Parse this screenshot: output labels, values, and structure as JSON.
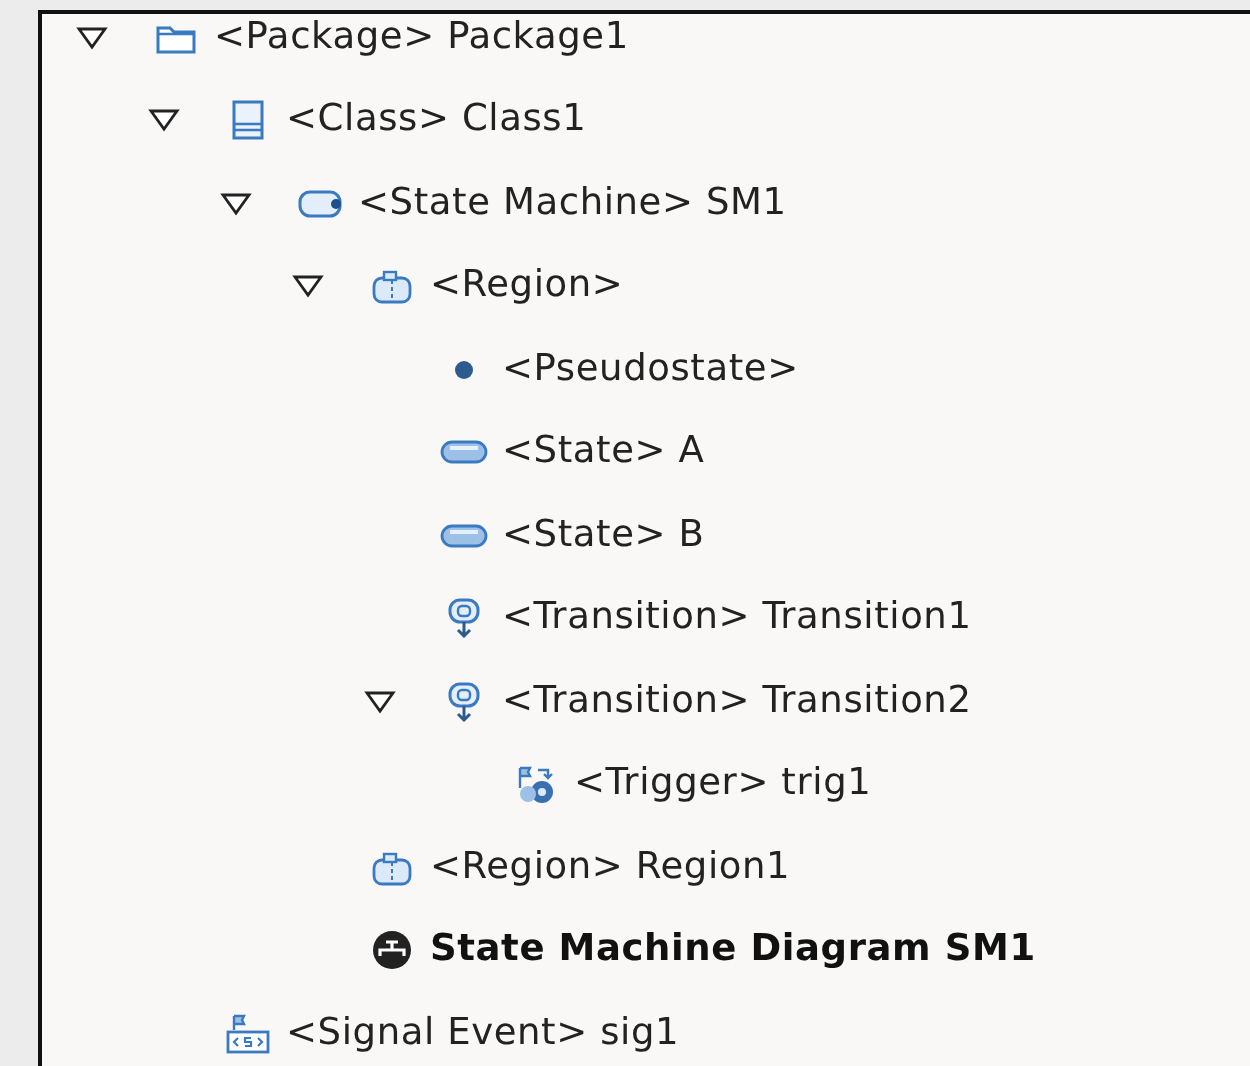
{
  "tree": {
    "items": [
      {
        "kind": "package",
        "label": "<Package> Package1",
        "expanded": true,
        "children": [
          {
            "kind": "class",
            "label": "<Class> Class1",
            "expanded": true,
            "children": [
              {
                "kind": "state-machine",
                "label": "<State Machine> SM1",
                "expanded": true,
                "children": [
                  {
                    "kind": "region",
                    "label": "<Region>",
                    "expanded": true,
                    "children": [
                      {
                        "kind": "pseudostate",
                        "label": "<Pseudostate>"
                      },
                      {
                        "kind": "state",
                        "label": "<State> A"
                      },
                      {
                        "kind": "state",
                        "label": "<State> B"
                      },
                      {
                        "kind": "transition",
                        "label": "<Transition> Transition1"
                      },
                      {
                        "kind": "transition",
                        "label": "<Transition> Transition2",
                        "expanded": true,
                        "children": [
                          {
                            "kind": "trigger",
                            "label": "<Trigger> trig1"
                          }
                        ]
                      }
                    ]
                  },
                  {
                    "kind": "region",
                    "label": "<Region> Region1"
                  },
                  {
                    "kind": "diagram",
                    "label": "State Machine Diagram SM1"
                  }
                ]
              }
            ]
          },
          {
            "kind": "signal-event",
            "label": "<Signal Event> sig1"
          }
        ]
      }
    ]
  }
}
